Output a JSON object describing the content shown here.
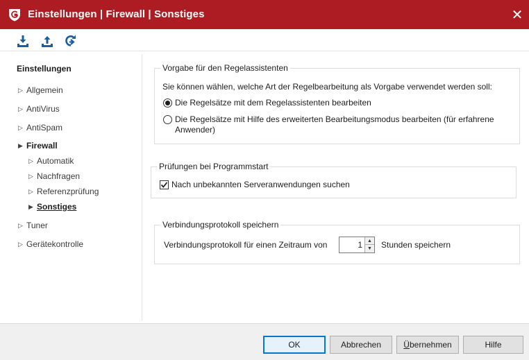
{
  "window": {
    "title": "Einstellungen | Firewall | Sonstiges",
    "close_label": "✕",
    "accent_color": "#ad1c22"
  },
  "toolbar": {
    "buttons": [
      {
        "name": "import-icon"
      },
      {
        "name": "export-icon"
      },
      {
        "name": "reset-icon"
      }
    ]
  },
  "sidebar": {
    "heading": "Einstellungen",
    "items": [
      {
        "label": "Allgemein"
      },
      {
        "label": "AntiVirus"
      },
      {
        "label": "AntiSpam"
      },
      {
        "label": "Firewall"
      },
      {
        "label": "Automatik"
      },
      {
        "label": "Nachfragen"
      },
      {
        "label": "Referenzprüfung"
      },
      {
        "label": "Sonstiges"
      },
      {
        "label": "Tuner"
      },
      {
        "label": "Gerätekontrolle"
      }
    ],
    "expanded_arrow": "▶",
    "collapsed_arrow": "▷"
  },
  "groups": {
    "regelassistent": {
      "title": "Vorgabe für den Regelassistenten",
      "description": "Sie können wählen, welche Art der Regelbearbeitung als Vorgabe verwendet werden soll:",
      "option1": "Die Regelsätze mit dem Regelassistenten bearbeiten",
      "option2_line1": "Die Regelsätze mit Hilfe des erweiterten Bearbeitungsmodus bearbeiten (für erfahrene",
      "option2_line2": "Anwender)",
      "selected": 1
    },
    "programmstart": {
      "title": "Prüfungen bei Programmstart",
      "checkbox_label": "Nach unbekannten Serveranwendungen suchen",
      "checked": true
    },
    "protokoll": {
      "title": "Verbindungsprotokoll speichern",
      "label_before": "Verbindungsprotokoll für einen Zeitraum von",
      "value": "1",
      "label_after": "Stunden speichern"
    }
  },
  "footer": {
    "ok": "OK",
    "cancel": "Abbrechen",
    "apply_prefix": "Ü",
    "apply_rest": "bernehmen",
    "help": "Hilfe"
  }
}
